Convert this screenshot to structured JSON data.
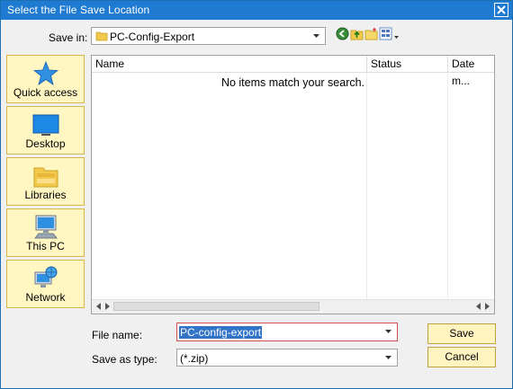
{
  "window": {
    "title": "Select the File Save Location"
  },
  "save_in": {
    "label": "Save in:",
    "value": "PC-Config-Export"
  },
  "places": [
    {
      "label": "Quick access",
      "icon": "star-icon"
    },
    {
      "label": "Desktop",
      "icon": "desktop-icon"
    },
    {
      "label": "Libraries",
      "icon": "libraries-icon"
    },
    {
      "label": "This PC",
      "icon": "computer-icon"
    },
    {
      "label": "Network",
      "icon": "network-icon"
    }
  ],
  "list": {
    "columns": [
      "Name",
      "Status",
      "Date m..."
    ],
    "empty_message": "No items match your search."
  },
  "file_name": {
    "label": "File name:",
    "value": "PC-config-export"
  },
  "save_as_type": {
    "label": "Save as type:",
    "value": "(*.zip)"
  },
  "buttons": {
    "save": "Save",
    "cancel": "Cancel"
  },
  "colors": {
    "titlebar": "#1f7ad1",
    "place_bg": "#fff6c2",
    "button_bg": "#fff4c0",
    "selection": "#3073c8"
  }
}
